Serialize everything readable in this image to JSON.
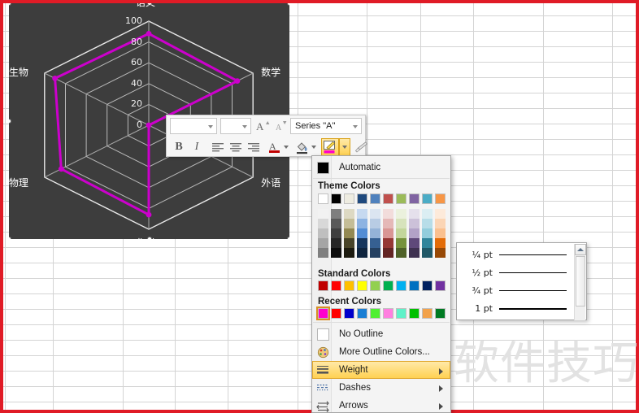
{
  "window": {
    "border_color": "#e01b26"
  },
  "watermark": {
    "text": "软件技巧"
  },
  "chart": {
    "background": "#3d3d3d",
    "series_color": "#cc00cc",
    "gridline_color": "#c9c9c9",
    "axis_ticks": [
      "100",
      "80",
      "60",
      "40",
      "20",
      "0"
    ],
    "categories": [
      "语文",
      "数学",
      "外语",
      "化学",
      "物理",
      "生物"
    ]
  },
  "chart_data": {
    "type": "radar",
    "title": "",
    "categories": [
      "语文",
      "数学",
      "外语",
      "化学",
      "物理",
      "生物"
    ],
    "series": [
      {
        "name": "Series \"A\"",
        "values": [
          88,
          85,
          0,
          86,
          84,
          90
        ],
        "color": "#cc00cc"
      }
    ],
    "ylim": [
      0,
      100
    ],
    "tick_values": [
      0,
      20,
      40,
      60,
      80,
      100
    ],
    "grid": true,
    "legend": "none",
    "xlabel": "",
    "ylabel": ""
  },
  "mini_toolbar": {
    "font_name": "",
    "font_name_placeholder": "",
    "font_size": "",
    "series_selector": "Series \"A\"",
    "bold_label": "B",
    "italic_label": "I",
    "align_left_label": "align-left",
    "align_center_label": "align-center",
    "align_right_label": "align-right",
    "font_color_label": "A",
    "fill_color_label": "fill",
    "outline_label": "outline",
    "format_painter_label": "format-painter"
  },
  "outline_menu": {
    "automatic_label": "Automatic",
    "automatic_color": "#000000",
    "theme_colors_title": "Theme Colors",
    "theme_colors": [
      [
        "#ffffff",
        "#f2f2f2",
        "#d8d8d8",
        "#bfbfbf",
        "#a5a5a5",
        "#7f7f7f"
      ],
      [
        "#000000",
        "#7f7f7f",
        "#595959",
        "#3f3f3f",
        "#262626",
        "#0c0c0c"
      ],
      [
        "#eeece1",
        "#ddd9c3",
        "#c4bd97",
        "#938953",
        "#494429",
        "#1d1b10"
      ],
      [
        "#1f497d",
        "#c6d9f0",
        "#8db3e2",
        "#548dd4",
        "#17365d",
        "#0f243e"
      ],
      [
        "#4f81bd",
        "#dbe5f1",
        "#b8cce4",
        "#95b3d7",
        "#366092",
        "#244061"
      ],
      [
        "#c0504d",
        "#f2dcdb",
        "#e5b8b7",
        "#d99694",
        "#953734",
        "#632423"
      ],
      [
        "#9bbb59",
        "#ebf1dd",
        "#d7e3bc",
        "#c3d69b",
        "#76923c",
        "#4f6128"
      ],
      [
        "#8064a2",
        "#e5e0ec",
        "#ccc1d9",
        "#b2a2c7",
        "#5f497a",
        "#3f3151"
      ],
      [
        "#4bacc6",
        "#dbeef3",
        "#b7dde8",
        "#92cddc",
        "#31859b",
        "#205867"
      ],
      [
        "#f79646",
        "#fdeada",
        "#fbd5b5",
        "#fac08f",
        "#e36c09",
        "#974806"
      ]
    ],
    "standard_colors_title": "Standard Colors",
    "standard_colors": [
      "#c00000",
      "#ff0000",
      "#ffc000",
      "#ffff00",
      "#92d050",
      "#00b050",
      "#00b0f0",
      "#0070c0",
      "#002060",
      "#7030a0"
    ],
    "recent_colors_title": "Recent Colors",
    "recent_colors": [
      "#ff00cc",
      "#ff0000",
      "#0000cc",
      "#1a7fd4",
      "#4ff032",
      "#ff7fe0",
      "#5ff2c8",
      "#00c000",
      "#f2a24b",
      "#007a22"
    ],
    "recent_selected_index": 0,
    "items": [
      {
        "label": "No Outline",
        "icon": "no-outline-icon",
        "submenu": false
      },
      {
        "label": "More Outline Colors...",
        "icon": "palette-icon",
        "submenu": false
      },
      {
        "label": "Weight",
        "icon": "weight-icon",
        "submenu": true,
        "selected": true
      },
      {
        "label": "Dashes",
        "icon": "dashes-icon",
        "submenu": true
      },
      {
        "label": "Arrows",
        "icon": "arrows-icon",
        "submenu": true
      }
    ]
  },
  "weight_menu": {
    "items": [
      {
        "label": "¼ pt",
        "thickness_px": 1
      },
      {
        "label": "½ pt",
        "thickness_px": 1
      },
      {
        "label": "¾ pt",
        "thickness_px": 1
      },
      {
        "label": "1 pt",
        "thickness_px": 2
      }
    ],
    "scrollbar": {
      "up_arrow": "scroll-up-icon"
    }
  }
}
